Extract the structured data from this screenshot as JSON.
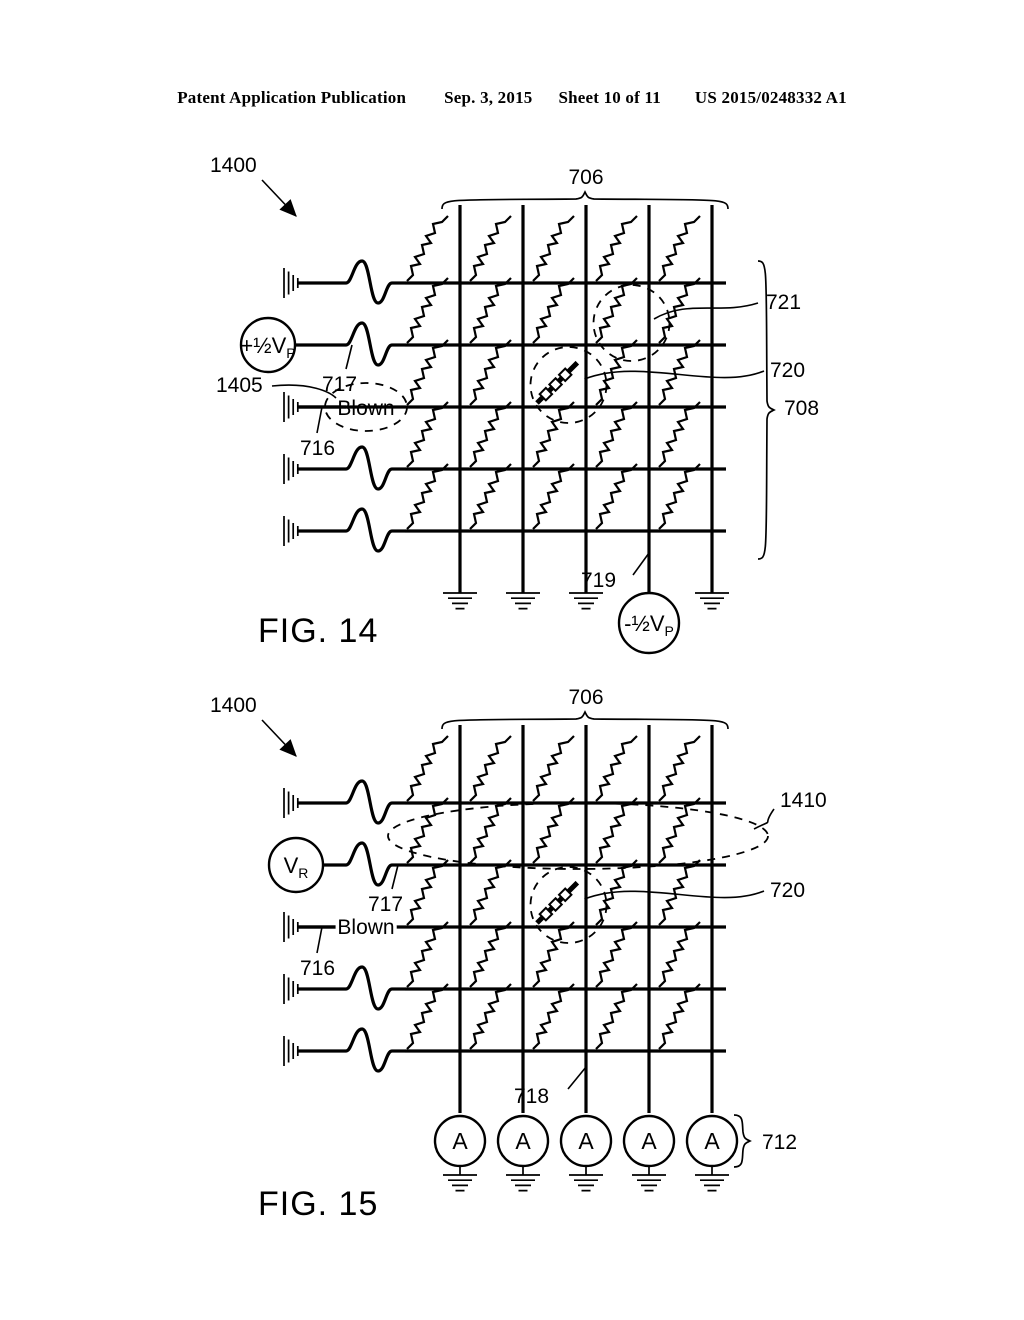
{
  "header": {
    "publication": "Patent Application Publication",
    "date": "Sep. 3, 2015",
    "sheet": "Sheet 10 of 11",
    "patent_number": "US 2015/0248332 A1"
  },
  "figures": [
    {
      "id": "fig14",
      "caption": "FIG. 14",
      "device_label": "1400",
      "column_bundle_label": "706",
      "row_bundle_label": "708",
      "row_line_label": "717",
      "column_line_label": "719",
      "ground_row_label": "716",
      "blown_callout_label": "1405",
      "blown_text": "Blown",
      "programmed_cell_label": "720",
      "half_selected_cell_label": "721",
      "row_source": {
        "sign": "+",
        "value": "½",
        "symbol": "V",
        "subscript": "P"
      },
      "col_source": {
        "sign": "-",
        "value": "½",
        "symbol": "V",
        "subscript": "P"
      },
      "grid": {
        "rows": 5,
        "cols": 5
      },
      "blown_cell": {
        "row": 3,
        "col": 3
      },
      "dashed_circle_cells": [
        {
          "row": 3,
          "col": 3
        },
        {
          "row": 2,
          "col": 4
        }
      ],
      "blown_row_index": 3,
      "col_source_index": 4,
      "row_terminations": [
        "ground",
        "source",
        "ground",
        "ground",
        "ground"
      ],
      "col_terminations": [
        "ground",
        "ground",
        "ground",
        "source",
        "ground"
      ],
      "blown_has_dashed_ellipse": true,
      "has_row_brace": true
    },
    {
      "id": "fig15",
      "caption": "FIG. 15",
      "device_label": "1400",
      "column_bundle_label": "706",
      "row_line_label": "717",
      "column_line_label": "718",
      "ground_row_label": "716",
      "blown_text": "Blown",
      "programmed_cell_label": "720",
      "read_row_callout_label": "1410",
      "ammeter_bundle_label": "712",
      "ammeter_text": "A",
      "row_source": {
        "sign": "",
        "value": "",
        "symbol": "V",
        "subscript": "R"
      },
      "grid": {
        "rows": 5,
        "cols": 5
      },
      "blown_cell": {
        "row": 3,
        "col": 3
      },
      "dashed_circle_cells": [
        {
          "row": 3,
          "col": 3
        }
      ],
      "blown_row_index": 3,
      "row_terminations": [
        "ground",
        "source",
        "ground",
        "ground",
        "ground"
      ],
      "col_terminations": [
        "ammeter",
        "ammeter",
        "ammeter",
        "ammeter",
        "ammeter"
      ],
      "blown_has_dashed_ellipse": false,
      "has_row_brace": false,
      "read_ellipse_row": 2
    }
  ],
  "colors": {
    "ink": "#000000",
    "paper": "#ffffff"
  }
}
